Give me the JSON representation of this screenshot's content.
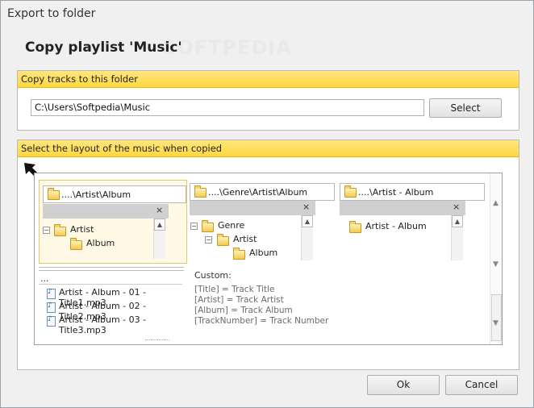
{
  "window": {
    "title": "Export to folder"
  },
  "heading": "Copy playlist 'Music'",
  "watermark": "SOFTPEDIA",
  "copy_group": {
    "header": "Copy tracks to this folder",
    "path_value": "C:\\Users\\Softpedia\\Music",
    "select_label": "Select"
  },
  "layout_group": {
    "header": "Select the layout of the music when copied",
    "options": [
      {
        "pattern": "....\\Artist\\Album",
        "tree": [
          "Artist",
          "Album"
        ],
        "selected": true
      },
      {
        "pattern": "....\\Genre\\Artist\\Album",
        "tree": [
          "Genre",
          "Artist",
          "Album"
        ],
        "selected": false
      },
      {
        "pattern": "....\\Artist - Album",
        "tree": [
          "Artist - Album"
        ],
        "selected": false
      }
    ],
    "files_panel": {
      "ellipsis": "...",
      "files": [
        "Artist - Album - 01 - Title1.mp3",
        "Artist - Album - 02 - Title2.mp3",
        "Artist - Album - 03 - Title3.mp3"
      ]
    },
    "custom": {
      "label": "Custom:",
      "hints": [
        "[Title] = Track Title",
        "[Artist] = Track Artist",
        "[Album] = Track Album",
        "[TrackNumber] = Track Number"
      ]
    },
    "close_glyph": "×",
    "scroll_up_glyph": "▲",
    "scroll_down_glyph": "▼"
  },
  "footer": {
    "ok_label": "Ok",
    "cancel_label": "Cancel"
  },
  "colors": {
    "accent_header": "#ffd840",
    "selected_panel": "#fff9e6"
  }
}
